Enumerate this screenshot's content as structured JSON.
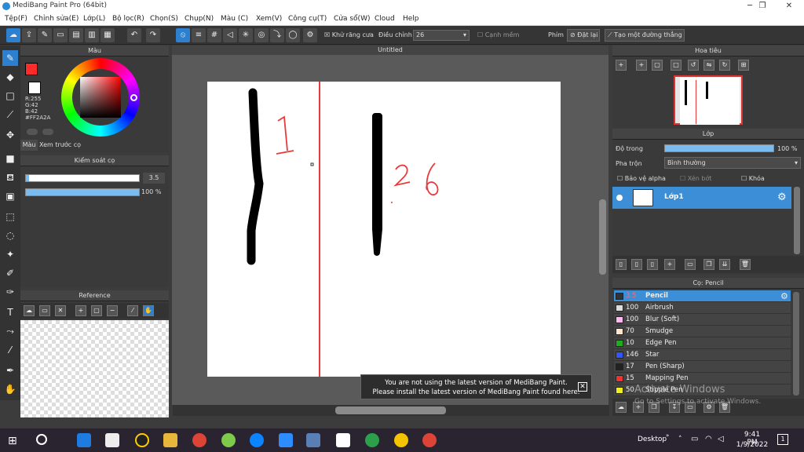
{
  "window": {
    "title": "MediBang Paint Pro (64bit)",
    "minimize": "─",
    "maximize": "❐",
    "close": "✕"
  },
  "menu": [
    "Tệp(F)",
    "Chỉnh sửa(E)",
    "Lớp(L)",
    "Bộ lọc(R)",
    "Chọn(S)",
    "Chụp(N)",
    "Màu (C)",
    "Xem(V)",
    "Công cụ(T)",
    "Cửa sổ(W)",
    "Cloud",
    "Help"
  ],
  "toolbar": {
    "antialias_label": "Khử răng cưa",
    "adjust_label": "Điều chỉnh",
    "adjust_value": "26",
    "sharp_label": "Cạnh mềm",
    "keys_label": "Phím",
    "reset_label": "Đặt lại",
    "create_label": "Tạo một đường thẳng"
  },
  "color_panel": {
    "title": "Màu",
    "r": "R:255",
    "g": "G:42",
    "b": "B:42",
    "hex": "#FF2A2A",
    "tab_color": "Màu",
    "tab_preview": "Xem trước cọ",
    "accent": "#ff2a2a"
  },
  "brush_control": {
    "title": "Kiểm soát cọ",
    "size": "3.5",
    "opacity": "100 %",
    "size_fraction": 0.03,
    "opacity_fraction": 1.0
  },
  "reference": {
    "title": "Reference"
  },
  "canvas": {
    "tab": "Untitled",
    "annotations": [
      "1",
      "2",
      "6"
    ]
  },
  "notice": {
    "line1": "You are not using the latest version of MediBang Paint.",
    "line2": "Please install the latest version of MediBang Paint found here."
  },
  "navigator": {
    "title": "Hoa tiêu"
  },
  "layers": {
    "title": "Lớp",
    "opacity_label": "Độ trong",
    "opacity_value": "100 %",
    "blend_label": "Pha trộn",
    "blend_value": "Bình thường",
    "protect_alpha": "Bảo vệ alpha",
    "clip": "Xén bớt",
    "lock": "Khóa",
    "layer_name": "Lớp1"
  },
  "brushes": {
    "title": "Cọ: Pencil",
    "items": [
      {
        "size": "3.5",
        "name": "Pencil",
        "color": "#333333"
      },
      {
        "size": "100",
        "name": "Airbrush",
        "color": "#dddddd"
      },
      {
        "size": "100",
        "name": "Blur (Soft)",
        "color": "#ffbbee"
      },
      {
        "size": "70",
        "name": "Smudge",
        "color": "#ffe6cc"
      },
      {
        "size": "10",
        "name": "Edge Pen",
        "color": "#22aa22"
      },
      {
        "size": "146",
        "name": "Star",
        "color": "#3355ff"
      },
      {
        "size": "17",
        "name": "Pen (Sharp)",
        "color": "#222222"
      },
      {
        "size": "15",
        "name": "Mapping Pen",
        "color": "#ee3333"
      },
      {
        "size": "50",
        "name": "Stipple Pen",
        "color": "#eeee22"
      }
    ]
  },
  "watermark": {
    "line1": "Activate Windows",
    "line2": "Go to Settings to activate Windows."
  },
  "taskbar": {
    "desktop": "Desktop",
    "time": "9:41 PM",
    "date": "1/9/2022",
    "notif": "1"
  }
}
